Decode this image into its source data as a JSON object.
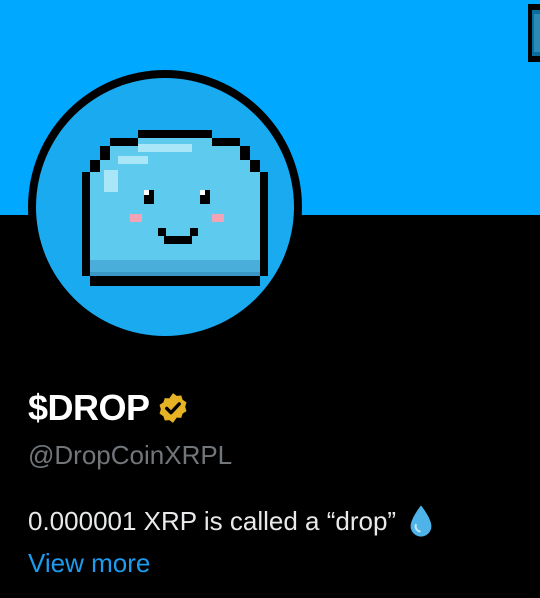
{
  "profile": {
    "display_name": "$DROP",
    "handle": "@DropCoinXRPL",
    "bio": "0.000001 XRP is called a “drop”",
    "view_more_label": "View more"
  },
  "icons": {
    "verified": "verified-badge-icon",
    "bio_emoji": "droplet-icon",
    "banner_edge": "partial-pixel-art-icon"
  },
  "colors": {
    "banner": "#00A8FF",
    "avatar_bg": "#19AAF0",
    "slime_body": "#5ECBEE",
    "verified_gold": "#E6B325",
    "link": "#1D9BF0",
    "handle_gray": "#71767B"
  }
}
